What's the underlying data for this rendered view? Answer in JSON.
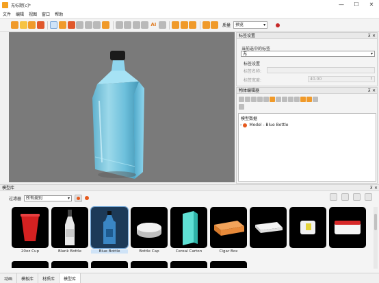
{
  "window": {
    "title": "无标题[c]*",
    "controls": [
      "—",
      "☐",
      "✕"
    ]
  },
  "menu": [
    "文件",
    "编辑",
    "视图",
    "窗口",
    "帮助"
  ],
  "toolbar": {
    "quality_label": "质量",
    "quality_value": "预览",
    "ai_label": "AI"
  },
  "tag_panel": {
    "title": "标签设置",
    "current_label": "当前选中的标签",
    "current_value": "无",
    "section_label": "标签设置",
    "name_label": "标签名称:",
    "width_label": "标签宽度:",
    "width_value": "40.00"
  },
  "object_editor": {
    "title": "物体编辑器",
    "tree_header": "模型数据",
    "tree_item": "Model - Blue Bottle"
  },
  "model_library": {
    "title": "模型库",
    "filter_label": "过滤器",
    "filter_value": "所有类别",
    "items": [
      {
        "name": "20oz Cup",
        "selected": false
      },
      {
        "name": "Blank Bottle",
        "selected": false
      },
      {
        "name": "Blue Bottle",
        "selected": true
      },
      {
        "name": "Bottle Cap",
        "selected": false
      },
      {
        "name": "Cereal Carton",
        "selected": false
      },
      {
        "name": "Cigar Box",
        "selected": false
      },
      {
        "name": "",
        "selected": false
      },
      {
        "name": "",
        "selected": false
      },
      {
        "name": "",
        "selected": false
      }
    ]
  },
  "bottom_tabs": [
    {
      "label": "动画",
      "active": false
    },
    {
      "label": "模板库",
      "active": false
    },
    {
      "label": "材质库",
      "active": false
    },
    {
      "label": "模型库",
      "active": true
    }
  ],
  "colors": {
    "accent": "#f09a2a",
    "selection": "#cfe3f7",
    "viewport_bg": "#7a7a7a",
    "bottle": "#7fd2ef"
  }
}
